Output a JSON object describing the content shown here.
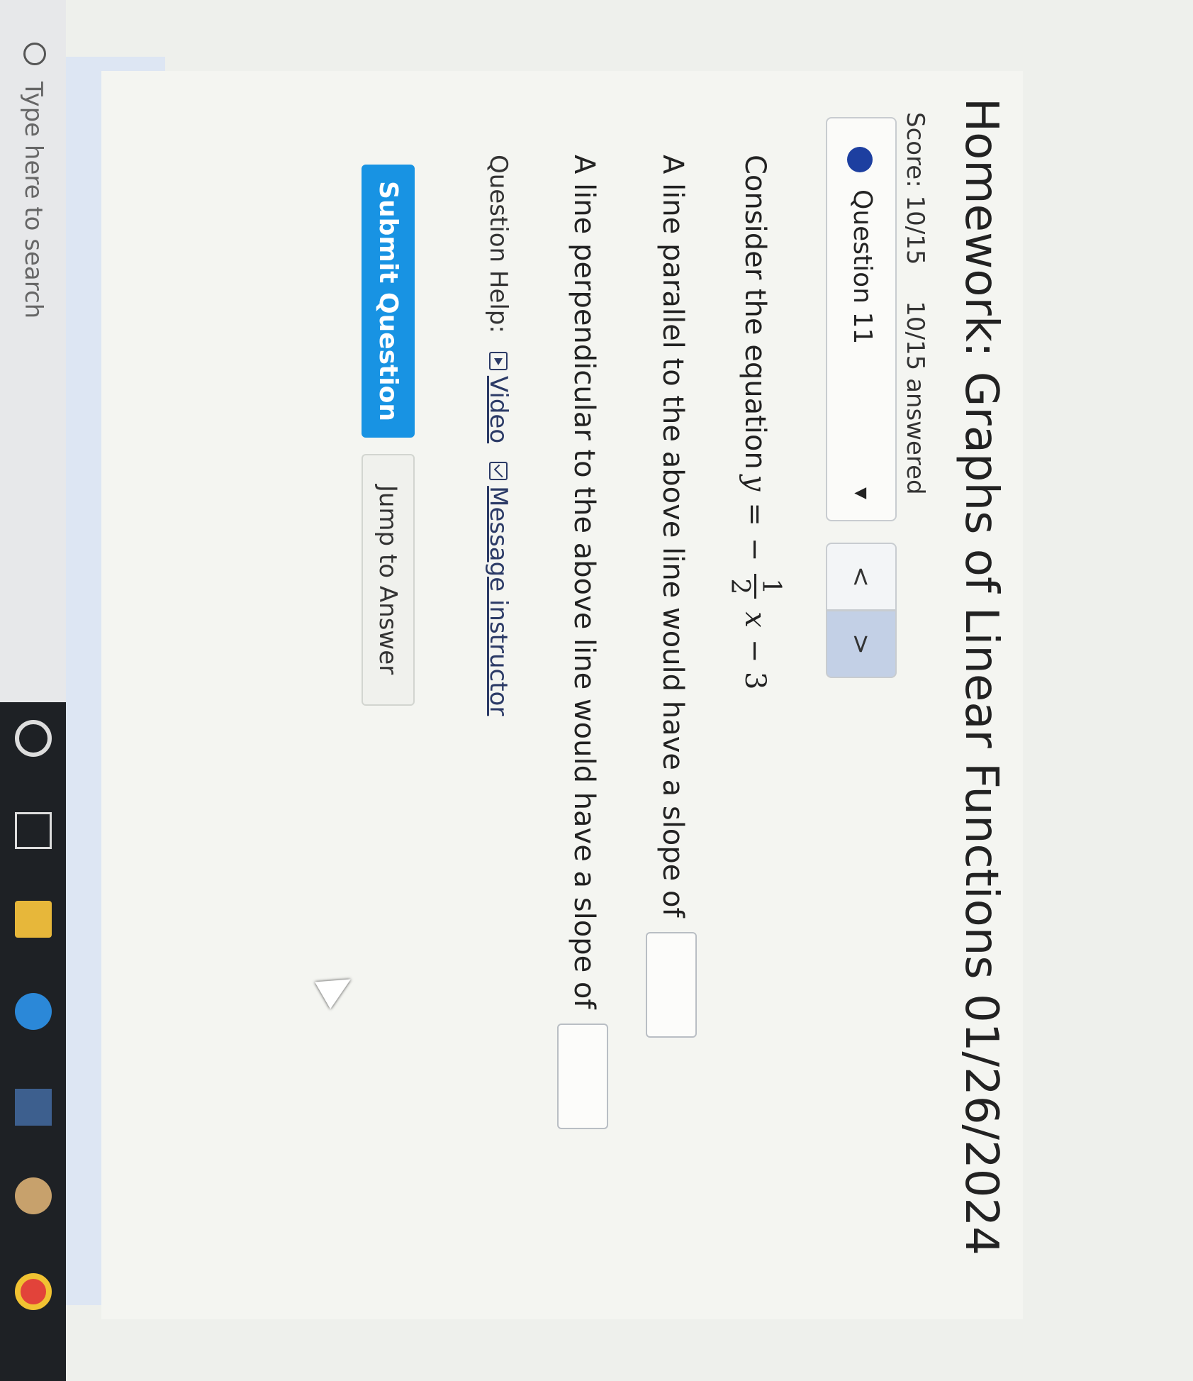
{
  "header": {
    "title": "Homework: Graphs of Linear Functions 01/26/2024",
    "score": "Score: 10/15",
    "answered": "10/15 answered"
  },
  "question_nav": {
    "selected": "Question 11",
    "prev_label": "<",
    "next_label": ">"
  },
  "question": {
    "consider_prefix": "Consider the equation",
    "eq_y": "y",
    "eq_equals": "=",
    "eq_minus": "−",
    "frac_num": "1",
    "frac_den": "2",
    "eq_x": "x",
    "eq_const": "− 3",
    "parallel_text": "A line parallel to the above line would have a slope of",
    "parallel_value": "",
    "perpendicular_text": "A line perpendicular to the above line would have a slope of",
    "perpendicular_value": ""
  },
  "help": {
    "label": "Question Help:",
    "video_label": "Video",
    "message_label": "Message instructor"
  },
  "actions": {
    "submit_label": "Submit Question",
    "jump_label": "Jump to Answer"
  },
  "taskbar": {
    "search_placeholder": "Type here to search"
  }
}
